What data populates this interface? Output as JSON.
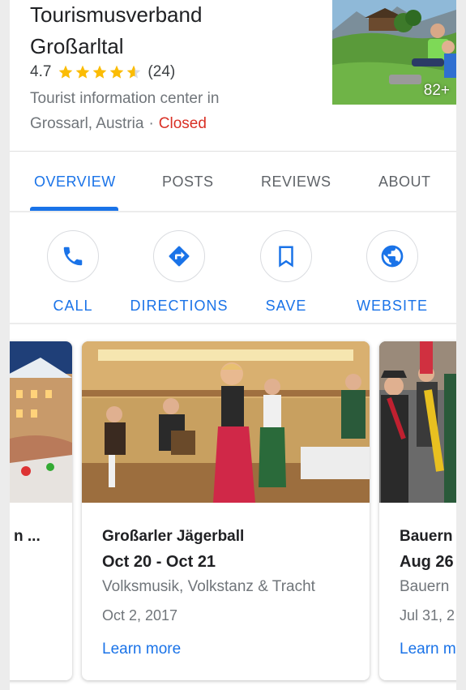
{
  "place": {
    "name_line1": "Tourismusverband",
    "name_line2": "Großarltal",
    "rating": "4.7",
    "rating_stars": 4.7,
    "review_count": "(24)",
    "category_line1": "Tourist information center in",
    "category_line2": "Grossarl, Austria",
    "separator": "·",
    "status": "Closed",
    "photo_count": "82+"
  },
  "tabs": [
    {
      "label": "OVERVIEW",
      "active": true
    },
    {
      "label": "POSTS"
    },
    {
      "label": "REVIEWS"
    },
    {
      "label": "ABOUT"
    }
  ],
  "actions": [
    {
      "label": "CALL",
      "icon": "phone-icon"
    },
    {
      "label": "DIRECTIONS",
      "icon": "directions-icon"
    },
    {
      "label": "SAVE",
      "icon": "bookmark-icon"
    },
    {
      "label": "WEBSITE",
      "icon": "globe-icon"
    }
  ],
  "events": [
    {
      "title": "n ..."
    },
    {
      "title": "Großarler Jägerball",
      "dates": "Oct 20 - Oct 21",
      "description": "Volksmusik, Volkstanz & Tracht",
      "posted": "Oct 2, 2017",
      "link": "Learn more"
    },
    {
      "title": "Bauern",
      "dates": "Aug 26",
      "description": "Bauern",
      "posted": "Jul 31, 2",
      "link": "Learn m"
    }
  ],
  "colors": {
    "accent": "#1a73e8",
    "closed": "#d93025",
    "star": "#fbbc04"
  }
}
